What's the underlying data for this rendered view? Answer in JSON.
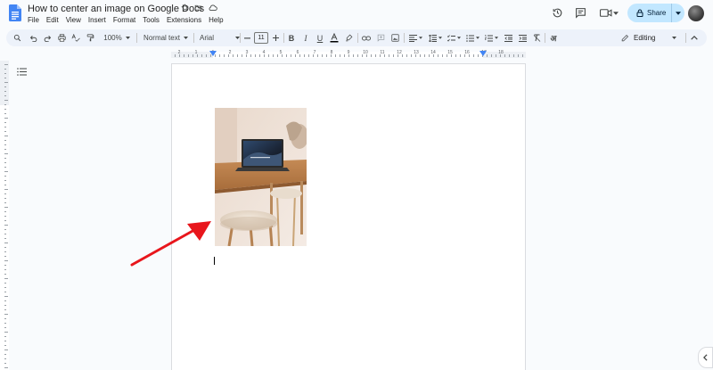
{
  "document": {
    "title": "How to center an image on Google Docs"
  },
  "menu": [
    "File",
    "Edit",
    "View",
    "Insert",
    "Format",
    "Tools",
    "Extensions",
    "Help"
  ],
  "header": {
    "share_label": "Share"
  },
  "toolbar": {
    "zoom": "100%",
    "style": "Normal text",
    "font": "Arial",
    "font_size": "11",
    "mode": "Editing",
    "input_tool": "अ"
  },
  "ruler": {
    "marks": [
      "2",
      "1",
      "1",
      "2",
      "3",
      "4",
      "5",
      "6",
      "7",
      "8",
      "9",
      "10",
      "11",
      "12",
      "13",
      "14",
      "15",
      "16",
      "17",
      "18"
    ]
  },
  "colors": {
    "accent": "#0b57d0",
    "share_bg": "#c2e7ff",
    "toolbar_bg": "#edf2fa",
    "annotation_arrow": "#e8161c"
  },
  "icons": {
    "docs_logo": "google-docs-logo",
    "star": "star-icon",
    "folder": "move-folder-icon",
    "cloud": "cloud-saved-icon",
    "history": "history-icon",
    "comments": "comment-icon",
    "meet": "video-call-icon",
    "lock": "lock-icon"
  }
}
